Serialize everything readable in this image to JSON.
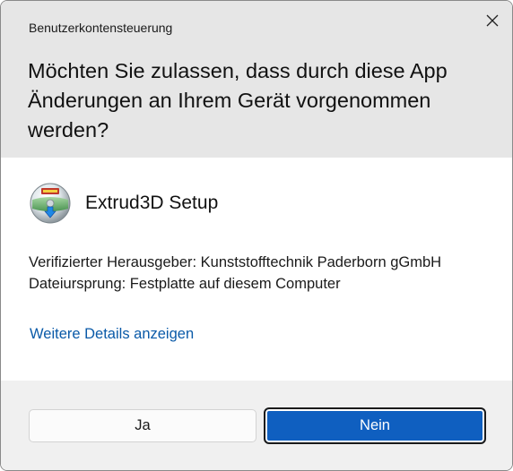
{
  "dialog": {
    "caption": "Benutzerkontensteuerung",
    "question": "Möchten Sie zulassen, dass durch diese App Änderungen an Ihrem Gerät vorgenommen werden?"
  },
  "app": {
    "name": "Extrud3D Setup",
    "icon": "installer-disc-icon"
  },
  "info": {
    "publisher": "Verifizierter Herausgeber: Kunststofftechnik Paderborn gGmbH",
    "origin": "Dateiursprung: Festplatte auf diesem Computer"
  },
  "link": {
    "details": "Weitere Details anzeigen"
  },
  "buttons": {
    "yes": "Ja",
    "no": "Nein"
  },
  "colors": {
    "header_bg": "#e6e6e6",
    "primary": "#0f5fc0",
    "link": "#0a5aa8"
  }
}
